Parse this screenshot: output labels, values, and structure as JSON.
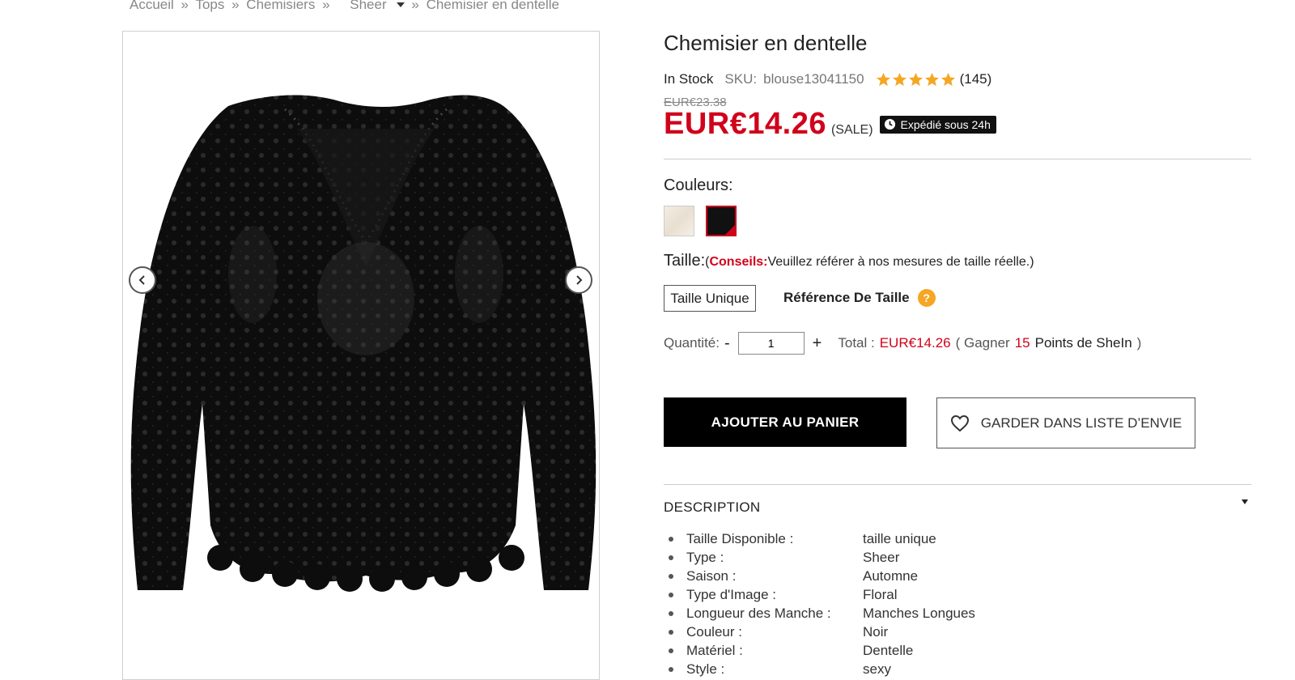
{
  "breadcrumb": {
    "items": [
      "Accueil",
      "Tops",
      "Chemisiers"
    ],
    "dropdown": "Sheer",
    "current": "Chemisier en dentelle",
    "sep": "»"
  },
  "product": {
    "title": "Chemisier en dentelle",
    "stock": "In Stock",
    "sku_label": "SKU:",
    "sku": "blouse13041150",
    "rating": 5,
    "reviews": "(145)",
    "old_price": "EUR€23.38",
    "price": "EUR€14.26",
    "sale": "(SALE)",
    "ship_badge": "Expédié sous 24h"
  },
  "colors": {
    "label": "Couleurs:",
    "options": [
      "beige",
      "noir"
    ],
    "selected": "noir"
  },
  "size": {
    "label": "Taille:",
    "tip_open": "(",
    "tip_strong": "Conseils:",
    "tip_text": "Veuillez référer à nos mesures de taille réelle.)",
    "option": "Taille Unique",
    "ref_label": "Référence De Taille",
    "ref_icon": "?"
  },
  "quantity": {
    "label": "Quantité:",
    "minus": "-",
    "value": "1",
    "plus": "+",
    "total_label": "Total :",
    "total": "EUR€14.26",
    "earn_open": "( Gagner",
    "points": "15",
    "earn_close": "Points de SheIn",
    "paren_close": ")"
  },
  "buttons": {
    "cart": "AJOUTER AU PANIER",
    "wishlist": "GARDER DANS LISTE D’ENVIE"
  },
  "description": {
    "title": "DESCRIPTION",
    "rows": [
      {
        "k": "Taille Disponible :",
        "v": "taille unique"
      },
      {
        "k": "Type :",
        "v": "Sheer"
      },
      {
        "k": "Saison :",
        "v": "Automne"
      },
      {
        "k": "Type d'Image :",
        "v": "Floral"
      },
      {
        "k": "Longueur des Manche :",
        "v": "Manches Longues"
      },
      {
        "k": "Couleur :",
        "v": "Noir"
      },
      {
        "k": "Matériel :",
        "v": "Dentelle"
      },
      {
        "k": "Style :",
        "v": "sexy"
      }
    ]
  },
  "theme": {
    "accent": "#d0021b",
    "star": "#f5a623",
    "button": "#000000"
  }
}
